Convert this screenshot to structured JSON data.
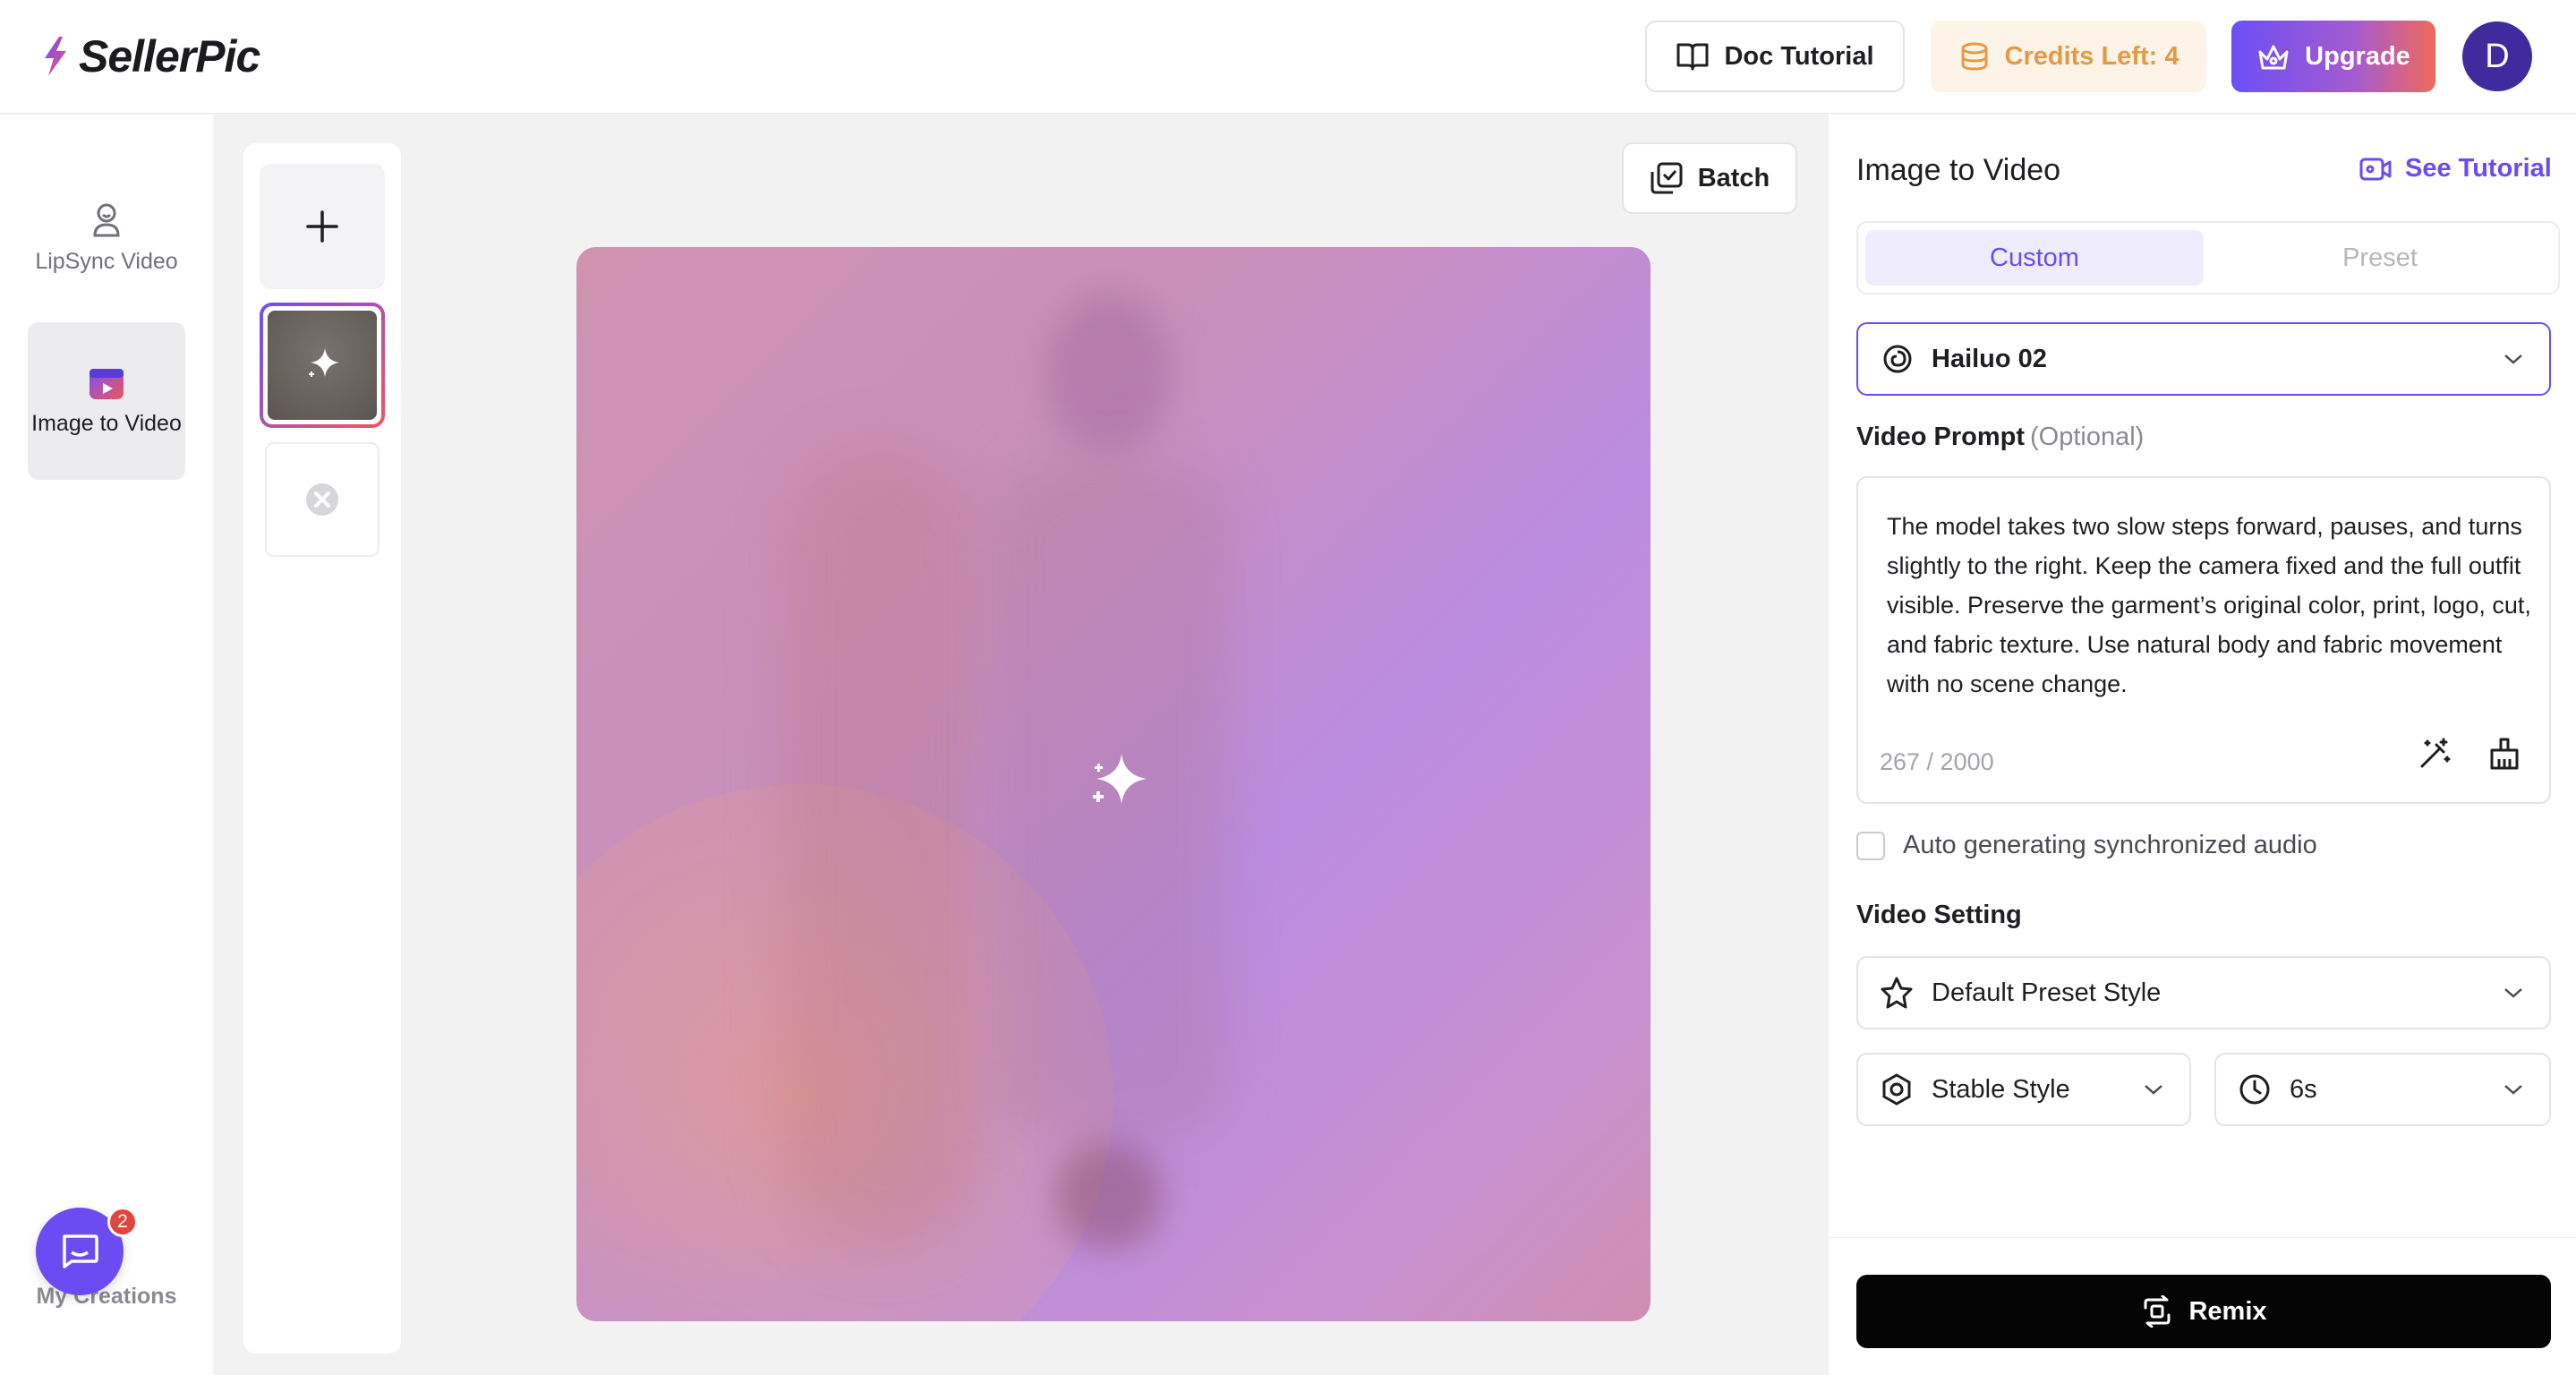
{
  "header": {
    "brand": "SellerPic",
    "doc_tutorial": "Doc Tutorial",
    "credits": "Credits Left: 4",
    "upgrade": "Upgrade",
    "avatar_initial": "D"
  },
  "rail": {
    "items": [
      {
        "label": "LipSync Video",
        "icon": "lipsync-icon",
        "active": false
      },
      {
        "label": "Image to Video",
        "icon": "image-to-video-icon",
        "active": true
      }
    ],
    "my_creations": "My Creations",
    "chat_badge": "2"
  },
  "canvas": {
    "batch": "Batch"
  },
  "panel": {
    "title": "Image to Video",
    "see_tutorial": "See Tutorial",
    "tabs": [
      {
        "label": "Custom",
        "active": true
      },
      {
        "label": "Preset",
        "active": false
      }
    ],
    "model": "Hailuo 02",
    "prompt_label": "Video Prompt",
    "prompt_optional": "(Optional)",
    "prompt_text": "The model takes two slow steps forward, pauses, and turns slightly to the right. Keep the camera fixed and the full outfit visible. Preserve the garment’s original color, print, logo, cut, and fabric texture. Use natural body and fabric movement with no scene change.",
    "prompt_counter": "267 / 2000",
    "audio_checkbox": "Auto generating synchronized audio",
    "audio_checked": false,
    "video_setting_label": "Video Setting",
    "preset_style": "Default Preset Style",
    "stable_style": "Stable Style",
    "duration": "6s",
    "remix": "Remix"
  },
  "colors": {
    "accent": "#6a4cf2",
    "credits_text": "#e39a45",
    "credits_bg": "#fdf3e6",
    "remix_bg": "#050505"
  }
}
